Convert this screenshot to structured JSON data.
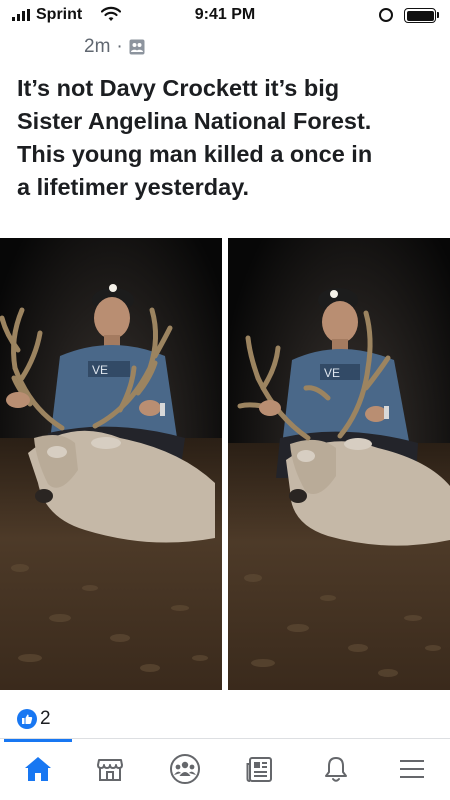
{
  "status_bar": {
    "carrier": "Sprint",
    "time": "9:41 PM",
    "signal_icon": "signal-bars-icon",
    "wifi_icon": "wifi-icon",
    "orientation_lock_icon": "orientation-lock-icon",
    "battery_icon": "battery-icon"
  },
  "post": {
    "timestamp": "2m",
    "separator": "·",
    "audience_icon": "group-audience-icon",
    "text_lines": [
      "It’s not Davy Crockett it’s big",
      "Sister Angelina National Forest.",
      "This young man killed a once in",
      "a lifetimer yesterday."
    ],
    "photos": [
      "hunter-with-deer-photo-1",
      "hunter-with-deer-photo-2"
    ],
    "reactions": {
      "icon": "like-icon",
      "count": "2"
    }
  },
  "tab_bar": {
    "active_tab": "home",
    "tabs": [
      {
        "id": "home",
        "icon": "home-icon"
      },
      {
        "id": "marketplace",
        "icon": "marketplace-icon"
      },
      {
        "id": "groups",
        "icon": "groups-icon"
      },
      {
        "id": "news",
        "icon": "news-icon"
      },
      {
        "id": "notifications",
        "icon": "bell-icon"
      },
      {
        "id": "menu",
        "icon": "menu-icon"
      }
    ]
  },
  "colors": {
    "brand_blue": "#1877f2",
    "text": "#1c1e21",
    "secondary_text": "#606770",
    "icon_gray": "#65676b"
  }
}
